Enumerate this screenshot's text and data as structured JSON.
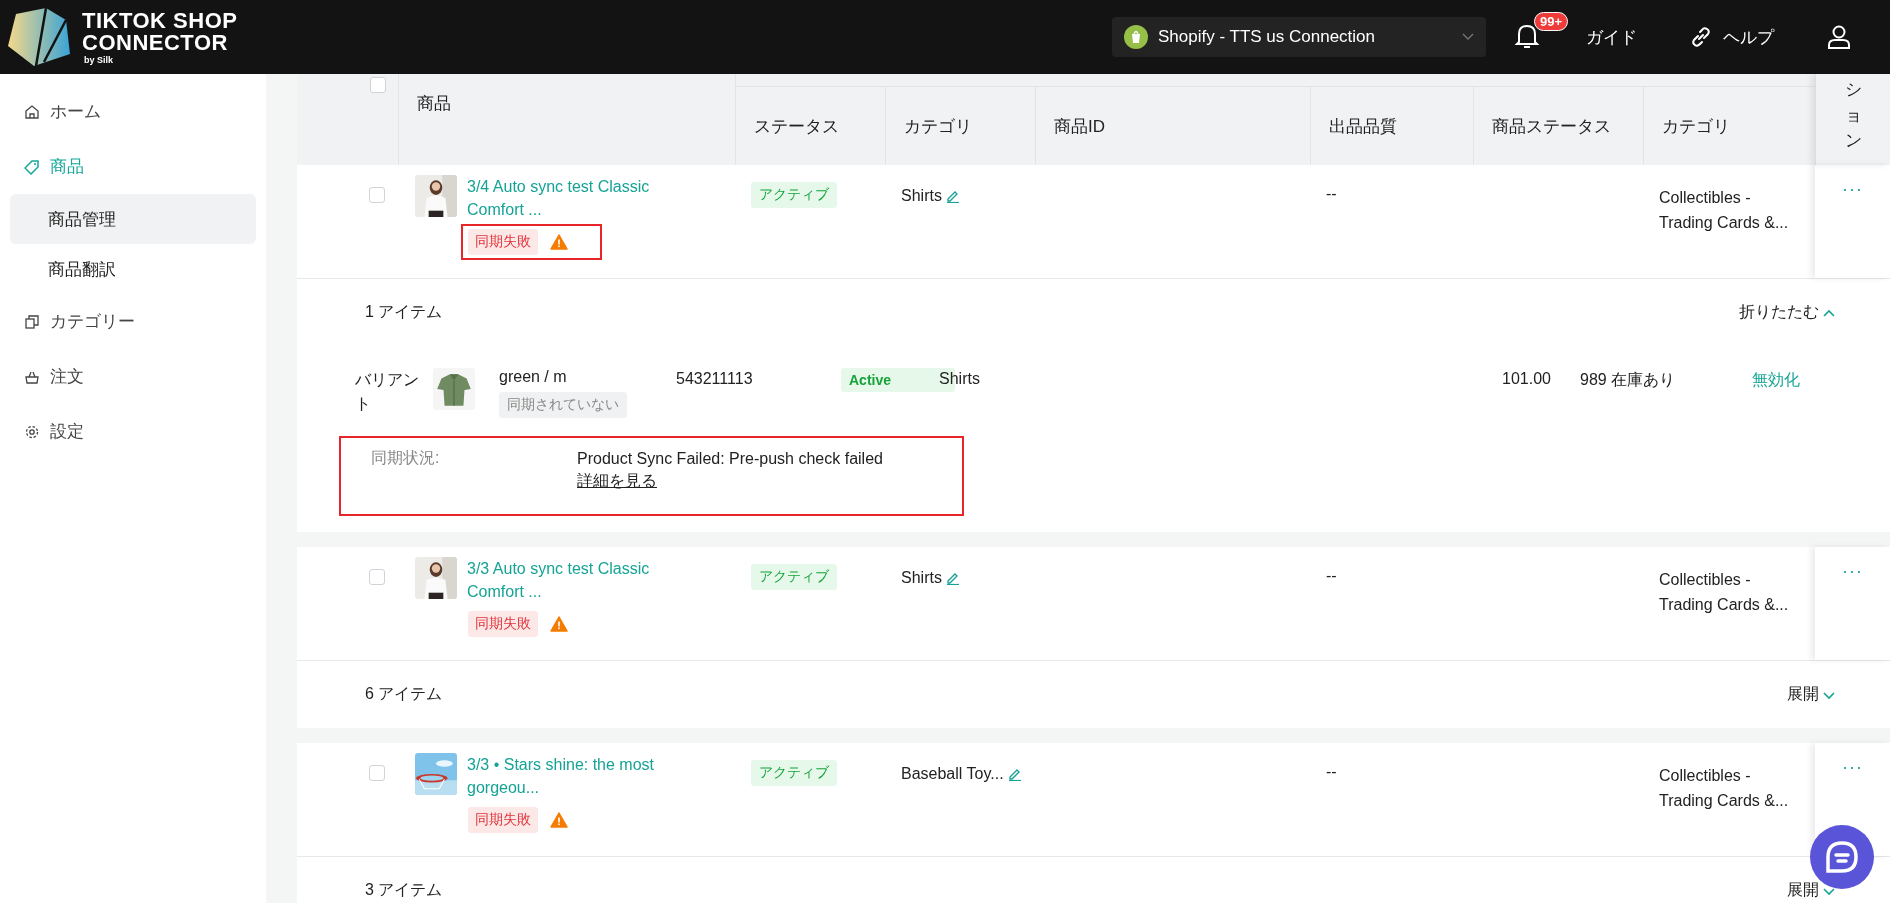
{
  "header": {
    "logo": {
      "line1": "TIKTOK SHOP",
      "line2": "CONNECTOR",
      "byline": "by Silk"
    },
    "store_select": {
      "value": "Shopify - TTS us Connection"
    },
    "notifications": {
      "badge": "99+"
    },
    "guide_link": "ガイド",
    "help_link": "ヘルプ"
  },
  "sidebar": {
    "items": [
      {
        "label": "ホーム",
        "selected": false
      },
      {
        "label": "商品",
        "selected": true,
        "children": [
          {
            "label": "商品管理",
            "selected": true
          },
          {
            "label": "商品翻訳",
            "selected": false
          }
        ]
      },
      {
        "label": "カテゴリー",
        "selected": false
      },
      {
        "label": "注文",
        "selected": false
      },
      {
        "label": "設定",
        "selected": false
      }
    ]
  },
  "table": {
    "header_checkbox": {
      "checked": false
    },
    "columns": [
      "商品",
      "ステータス",
      "カテゴリ",
      "商品ID",
      "出品品質",
      "商品ステータス",
      "カテゴリ",
      "ション"
    ],
    "rows": [
      {
        "checked": false,
        "thumbnail": {
          "kind": "picture"
        },
        "title_lines": [
          "3/4 Auto sync test Classic",
          "Comfort ..."
        ],
        "sync_badge": "同期失敗",
        "warning": true,
        "highlighted": true,
        "status": "アクティブ",
        "category": "Shirts",
        "category_editable": true,
        "quality": "--",
        "category2": "Collectibles - Trading Cards &...",
        "actions": "···",
        "summary": {
          "count": "1 アイテム",
          "toggle": "折りたたむ",
          "expanded": true
        },
        "variants": [
          {
            "label": "バリアント",
            "thumbnail": {
              "kind": "picture"
            },
            "name": "green / m",
            "sync_tag": "同期されていない",
            "id": "543211113",
            "status": "Active",
            "category": "Shirts",
            "price": "101.00",
            "stock": "989 在庫あり",
            "action": "無効化"
          }
        ],
        "sync_status": {
          "label": "同期状況:",
          "message": "Product Sync Failed: Pre-push check failed",
          "link": "詳細を見る",
          "highlighted": true
        }
      },
      {
        "checked": false,
        "thumbnail": {
          "kind": "picture"
        },
        "title_lines": [
          "3/3 Auto sync test Classic",
          "Comfort ..."
        ],
        "sync_badge": "同期失敗",
        "warning": true,
        "highlighted": false,
        "status": "アクティブ",
        "category": "Shirts",
        "category_editable": true,
        "quality": "--",
        "category2": "Collectibles - Trading Cards &...",
        "actions": "···",
        "summary": {
          "count": "6 アイテム",
          "toggle": "展開",
          "expanded": false
        }
      },
      {
        "checked": false,
        "thumbnail": {
          "kind": "picture"
        },
        "title_lines": [
          "3/3 • Stars shine: the most",
          "gorgeou..."
        ],
        "sync_badge": "同期失敗",
        "warning": true,
        "highlighted": false,
        "status": "アクティブ",
        "category": "Baseball Toy...",
        "category_editable": true,
        "quality": "--",
        "category2": "Collectibles - Trading Cards &...",
        "actions": "···",
        "summary": {
          "count": "3 アイテム",
          "toggle": "展開",
          "expanded": false
        }
      }
    ]
  }
}
